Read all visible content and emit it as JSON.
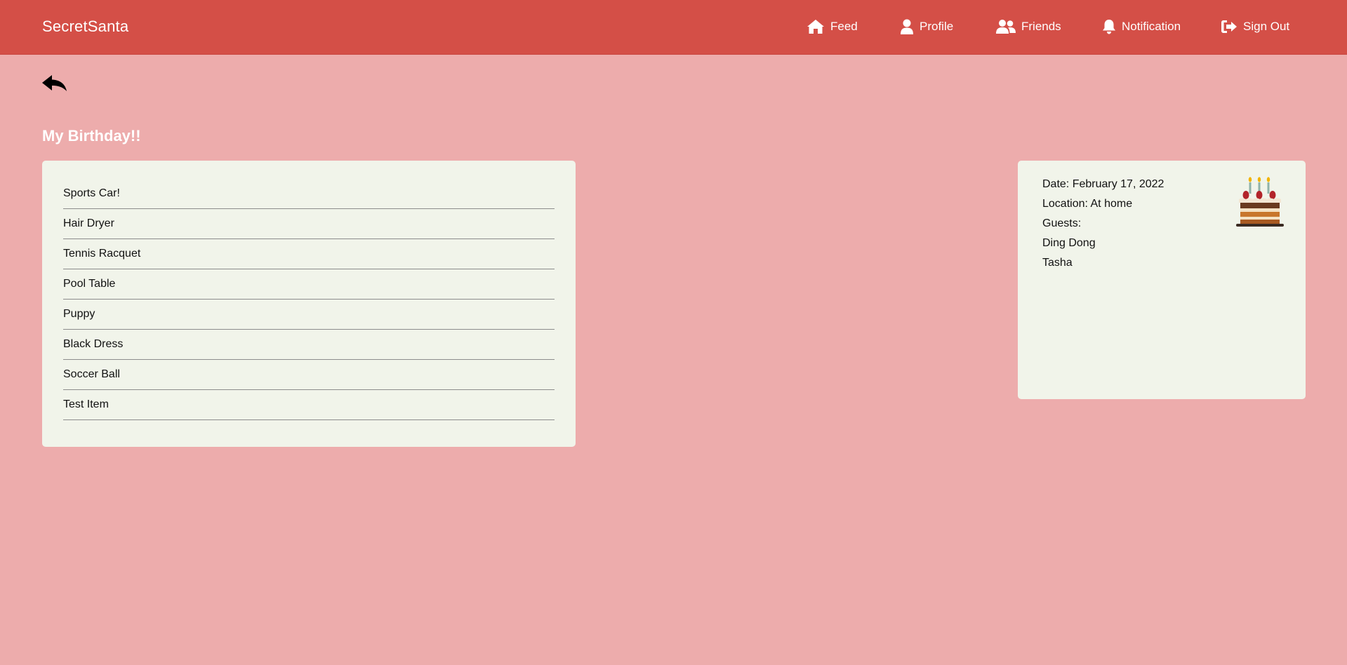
{
  "app": {
    "brand": "SecretSanta"
  },
  "nav": {
    "items": [
      {
        "label": "Feed",
        "icon": "home-icon"
      },
      {
        "label": "Profile",
        "icon": "user-icon"
      },
      {
        "label": "Friends",
        "icon": "users-icon"
      },
      {
        "label": "Notification",
        "icon": "bell-icon"
      },
      {
        "label": "Sign Out",
        "icon": "sign-out-icon"
      }
    ]
  },
  "event": {
    "title": "My Birthday!!",
    "date_line": "Date: February 17, 2022",
    "location_line": "Location: At home",
    "guests_label": "Guests:",
    "guests": [
      "Ding Dong",
      "Tasha"
    ],
    "icon": "birthday-cake-icon"
  },
  "wishlist": {
    "items": [
      "Sports Car!",
      "Hair Dryer",
      "Tennis Racquet",
      "Pool Table",
      "Puppy",
      "Black Dress",
      "Soccer Ball",
      "Test Item"
    ]
  },
  "colors": {
    "navbar": "#d44f47",
    "background": "#edacac",
    "card": "#f1f4ea"
  }
}
